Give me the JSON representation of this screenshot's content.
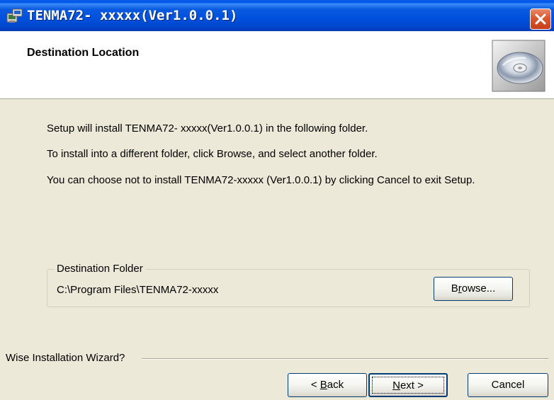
{
  "window": {
    "title": "TENMA72- xxxxx(Ver1.0.0.1)",
    "close_label": "×"
  },
  "header": {
    "title": "Destination Location",
    "icon": "cd-disc-icon"
  },
  "body": {
    "line1": "Setup will install TENMA72- xxxxx(Ver1.0.0.1) in the following folder.",
    "line2": "To install into a different folder, click Browse, and select another folder.",
    "line3": "You can choose not to install TENMA72-xxxxx (Ver1.0.0.1) by clicking Cancel to exit Setup."
  },
  "destination": {
    "group_label": "Destination Folder",
    "path": "C:\\Program Files\\TENMA72-xxxxx",
    "browse_prefix": "B",
    "browse_accel": "r",
    "browse_suffix": "owse..."
  },
  "footer": {
    "wizard_label": "Wise Installation Wizard?",
    "back_prefix": "< ",
    "back_accel": "B",
    "back_suffix": "ack",
    "next_accel": "N",
    "next_suffix": "ext >",
    "cancel_label": "Cancel"
  },
  "colors": {
    "titlebar": "#0054e3",
    "dialog_bg": "#ece9d8",
    "header_bg": "#ffffff",
    "close_button": "#d9582f",
    "button_border": "#003c74"
  }
}
